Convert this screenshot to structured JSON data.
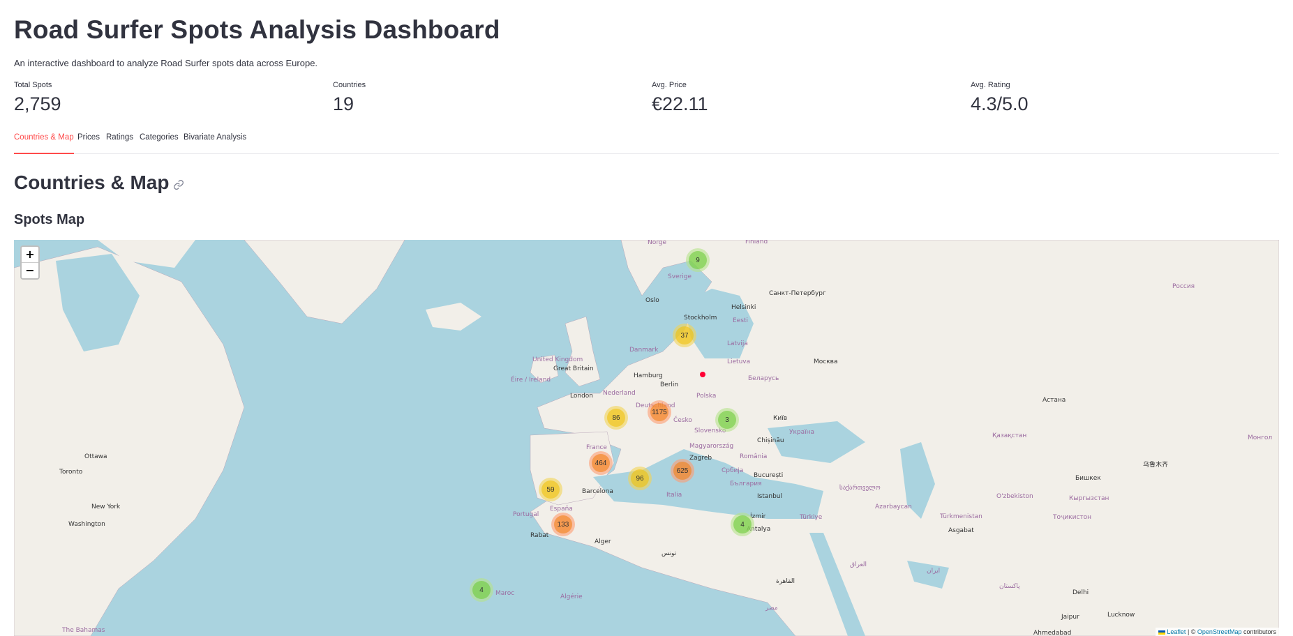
{
  "header": {
    "title": "Road Surfer Spots Analysis Dashboard",
    "subtitle": "An interactive dashboard to analyze Road Surfer spots data across Europe."
  },
  "metrics": [
    {
      "label": "Total Spots",
      "value": "2,759"
    },
    {
      "label": "Countries",
      "value": "19"
    },
    {
      "label": "Avg. Price",
      "value": "€22.11"
    },
    {
      "label": "Avg. Rating",
      "value": "4.3/5.0"
    }
  ],
  "tabs": [
    {
      "label": "Countries & Map",
      "active": true
    },
    {
      "label": "Prices",
      "active": false
    },
    {
      "label": "Ratings",
      "active": false
    },
    {
      "label": "Categories",
      "active": false
    },
    {
      "label": "Bivariate Analysis",
      "active": false
    }
  ],
  "section": {
    "title": "Countries & Map",
    "subtitle": "Spots Map"
  },
  "map": {
    "zoom_in": "+",
    "zoom_out": "−",
    "clusters": [
      {
        "count": "9",
        "size": "small"
      },
      {
        "count": "37",
        "size": "medium"
      },
      {
        "count": "86",
        "size": "medium"
      },
      {
        "count": "1175",
        "size": "large"
      },
      {
        "count": "3",
        "size": "small"
      },
      {
        "count": "464",
        "size": "large"
      },
      {
        "count": "96",
        "size": "medium"
      },
      {
        "count": "625",
        "size": "large"
      },
      {
        "count": "59",
        "size": "medium"
      },
      {
        "count": "133",
        "size": "large"
      },
      {
        "count": "4",
        "size": "small"
      },
      {
        "count": "4",
        "size": "small"
      }
    ],
    "labels": {
      "norge": "Norge",
      "finland": "Finland",
      "sverige": "Sverige",
      "oslo": "Oslo",
      "helsinki": "Helsinki",
      "spb": "Санкт-Петербург",
      "stockholm": "Stockholm",
      "eesti": "Eesti",
      "russia": "Россия",
      "latvija": "Latvija",
      "danmark": "Danmark",
      "uk": "United Kingdom",
      "gb": "Great Britain",
      "lietuva": "Lietuva",
      "moskva": "Москва",
      "eire": "Éire / Ireland",
      "hamburg": "Hamburg",
      "berlin": "Berlin",
      "belarus": "Беларусь",
      "nederland": "Nederland",
      "polska": "Polska",
      "london": "London",
      "deutschland": "Deutschland",
      "astana": "Астана",
      "cesko": "Česko",
      "kyiv": "Київ",
      "slovensko": "Slovensko",
      "ukraine": "Україна",
      "kazakhstan": "Қазақстан",
      "france": "France",
      "chisinau": "Chișinău",
      "magyar": "Magyarország",
      "mongol": "Монгол",
      "zagreb": "Zagreb",
      "romania": "România",
      "ottawa": "Ottawa",
      "urumqi": "乌鲁木齐",
      "toronto": "Toronto",
      "srbija": "Србија",
      "bucuresti": "București",
      "bishkek": "Бишкек",
      "bulgaria": "България",
      "barcelona": "Barcelona",
      "georgia": "საქართველო",
      "newyork": "New York",
      "istanbul": "Istanbul",
      "uzbekistan": "O'zbekiston",
      "italia": "Italia",
      "azerbaycan": "Azərbaycan",
      "kyrgyzstan": "Кыргызстан",
      "espana": "España",
      "portugal": "Portugal",
      "washington": "Washington",
      "turkmenistan": "Türkmenistan",
      "izmir": "İzmir",
      "tojikiston": "Тоҷикистон",
      "turkiye": "Türkiye",
      "ashgabat": "Asgabat",
      "antalya": "Antalya",
      "alger": "Alger",
      "rabat": "Rabat",
      "tunis": "تونس",
      "maroc": "Maroc",
      "algerie": "Algérie",
      "bahamas": "The Bahamas",
      "delhi": "Delhi",
      "jaipur": "Jaipur",
      "lucknow": "Lucknow",
      "ahmedabad": "Ahmedabad",
      "cairo": "القاهرة",
      "misr": "مصر",
      "iran": "ایران",
      "iraq": "العراق",
      "pakistan": "پاکستان"
    },
    "attribution": {
      "leaflet": "Leaflet",
      "sep": " | © ",
      "osm": "OpenStreetMap",
      "suffix": " contributors"
    }
  },
  "colors": {
    "accent": "#ff4b4b",
    "text": "#31333f",
    "water": "#aad3df",
    "land": "#f2efe9"
  }
}
